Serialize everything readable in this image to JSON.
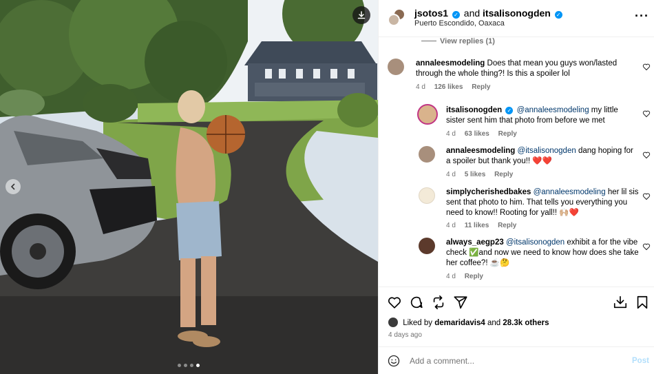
{
  "header": {
    "user1": "jsotos1",
    "conj": "and",
    "user2": "itsalisonogden",
    "location": "Puerto Escondido, Oaxaca",
    "more": "···"
  },
  "view_replies": "View replies (1)",
  "comments": [
    {
      "user": "annaleesmodeling",
      "mention": "",
      "text": "Does that mean you guys won/lasted through the whole thing?! Is this a spoiler lol",
      "time": "4 d",
      "likes": "126 likes",
      "reply": "Reply"
    },
    {
      "user": "itsalisonogden",
      "verified": true,
      "mention": "@annaleesmodeling",
      "text": "my little sister sent him that photo from before we met",
      "time": "4 d",
      "likes": "63 likes",
      "reply": "Reply"
    },
    {
      "user": "annaleesmodeling",
      "mention": "@itsalisonogden",
      "text": "dang hoping for a spoiler but thank you!! ❤️❤️",
      "time": "4 d",
      "likes": "5 likes",
      "reply": "Reply"
    },
    {
      "user": "simplycherishedbakes",
      "mention": "@annaleesmodeling",
      "text": "her lil sis sent that photo to him. That tells you everything you need to know!! Rooting for yall!! 🙌🏼❤️",
      "time": "4 d",
      "likes": "11 likes",
      "reply": "Reply"
    },
    {
      "user": "always_aegp23",
      "mention": "@itsalisonogden",
      "text": "exhibit a for the vibe check ✅and now we need to know how does she take her coffee?! ☕️🤔",
      "time": "4 d",
      "likes": "",
      "reply": "Reply"
    }
  ],
  "likes": {
    "prefix": "Liked by",
    "user": "demaridavis4",
    "conj": "and",
    "others": "28.3k others"
  },
  "posted_ago": "4 days ago",
  "add_comment": {
    "placeholder": "Add a comment...",
    "post_label": "Post"
  },
  "carousel": {
    "count": 4,
    "active": 4
  },
  "icons": {
    "download": "download-icon",
    "prev": "chevron-left-icon",
    "like": "heart-icon",
    "comment": "comment-icon",
    "repost": "repost-icon",
    "share": "share-icon",
    "save": "bookmark-icon",
    "emoji": "emoji-icon",
    "more": "more-icon"
  },
  "colors": {
    "mention": "#00376b",
    "verified": "#0095f6",
    "post_disabled": "#b2dffc",
    "secondary_text": "#737373"
  }
}
